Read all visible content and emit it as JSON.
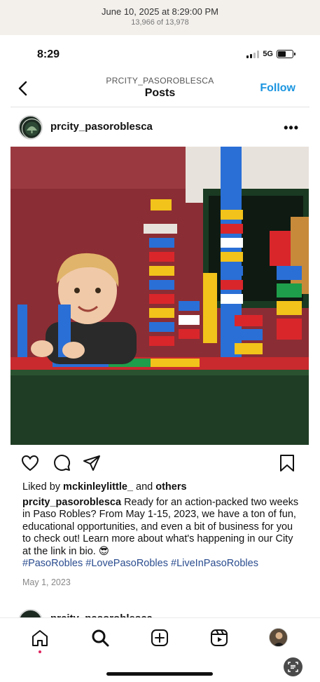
{
  "photos_header": {
    "date": "June 10, 2025 at 8:29:00 PM",
    "count": "13,966 of 13,978"
  },
  "status_bar": {
    "time": "8:29",
    "network": "5G"
  },
  "nav": {
    "account": "PRCITY_PASOROBLESCA",
    "heading": "Posts",
    "follow_label": "Follow"
  },
  "post": {
    "username": "prcity_pasoroblesca",
    "more_label": "•••",
    "liked_prefix": "Liked by",
    "liked_user": "mckinleylittle_",
    "liked_and": "and",
    "liked_others": "others",
    "caption_user": "prcity_pasoroblesca",
    "caption_text": "Ready for an action-packed two weeks in Paso Robles? From May 1-15, 2023, we have a ton of fun, educational opportunities, and even a bit of business for you to check out! Learn more about what's happening in our City at the link in bio. 😎",
    "hashtags": "#PasoRobles #LovePasoRobles #LiveInPasoRobles",
    "date": "May 1, 2023"
  },
  "next_post": {
    "username": "prcity_pasoroblesca"
  },
  "icons": {
    "back": "chevron-left-icon",
    "like": "heart-icon",
    "comment": "comment-icon",
    "share": "send-icon",
    "save": "bookmark-icon",
    "home": "home-icon",
    "search": "search-icon",
    "create": "plus-square-icon",
    "reels": "reels-icon"
  },
  "colors": {
    "follow": "#1b95e0",
    "hashtag": "#2a4c8f",
    "notification_dot": "#e0245e"
  }
}
